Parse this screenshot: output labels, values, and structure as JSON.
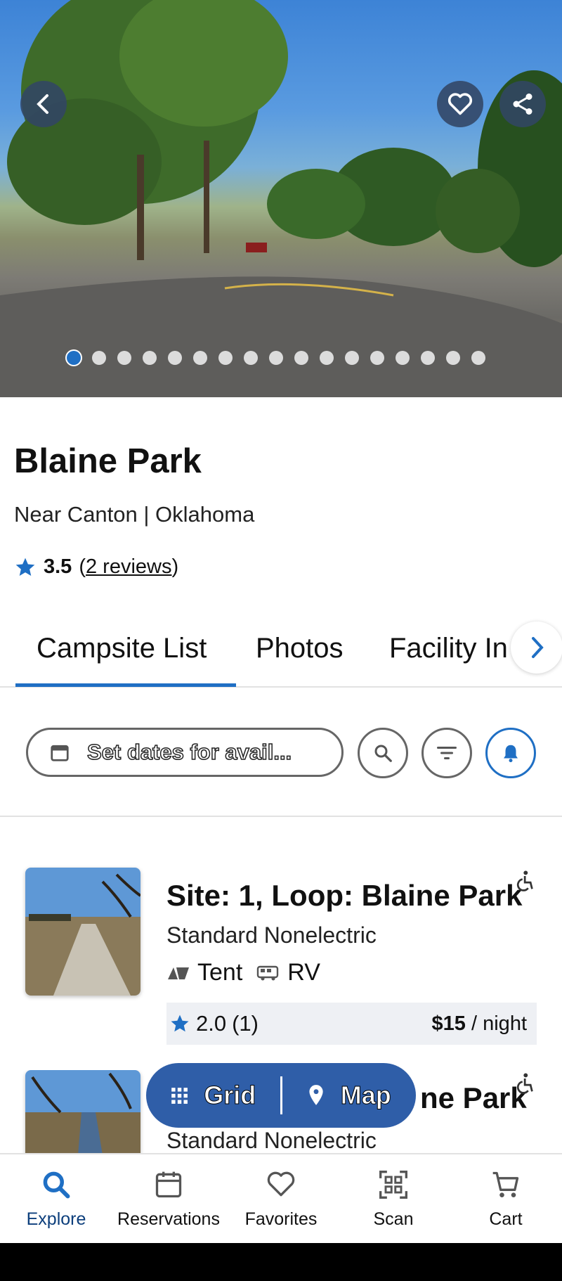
{
  "hero": {
    "dots_total": 17,
    "active_dot": 0
  },
  "park": {
    "name": "Blaine Park",
    "location": "Near Canton | Oklahoma",
    "rating": "3.5",
    "open_paren": "(",
    "reviews": "2 reviews",
    "close_paren": ")"
  },
  "tabs": [
    {
      "label": "Campsite List"
    },
    {
      "label": "Photos"
    },
    {
      "label": "Facility In"
    }
  ],
  "filter": {
    "date_placeholder": "Set dates for avail..."
  },
  "sites": [
    {
      "title": "Site: 1, Loop: Blaine Park",
      "type": "Standard Nonelectric",
      "amenity1": "Tent",
      "amenity2": "RV",
      "rating": "2.0",
      "count": "(1)",
      "price": "$15",
      "unit": "/ night"
    },
    {
      "title": "ne Park",
      "type": "Standard Nonelectric"
    }
  ],
  "view_toggle": {
    "grid": "Grid",
    "map": "Map"
  },
  "nav": [
    {
      "label": "Explore"
    },
    {
      "label": "Reservations"
    },
    {
      "label": "Favorites"
    },
    {
      "label": "Scan"
    },
    {
      "label": "Cart"
    }
  ],
  "colors": {
    "accent": "#1f6fc4",
    "toggle": "#2f5ea8",
    "nav_active": "#0d3f7c"
  }
}
